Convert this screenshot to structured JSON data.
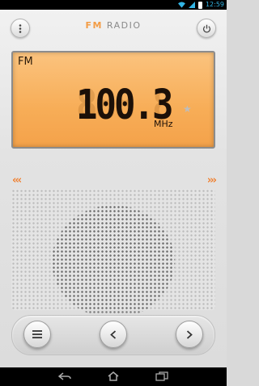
{
  "status": {
    "time": "12:59"
  },
  "app": {
    "title_accent": "FM",
    "title_rest": " RADIO"
  },
  "display": {
    "band": "FM",
    "frequency": "100.3",
    "ghost": "888.8",
    "unit": "MHz",
    "star": "★"
  },
  "tuning": {
    "left_arrows": "‹‹‹",
    "right_arrows": "›››"
  },
  "colors": {
    "accent": "#f08030",
    "display_bg": "#f7ad57",
    "status_blue": "#33b5e5"
  },
  "icons": {
    "menu": "overflow-menu-icon",
    "power": "power-icon",
    "list": "list-icon",
    "prev": "chevron-left-icon",
    "next": "chevron-right-icon",
    "back": "back-icon",
    "home": "home-icon",
    "recents": "recents-icon"
  }
}
